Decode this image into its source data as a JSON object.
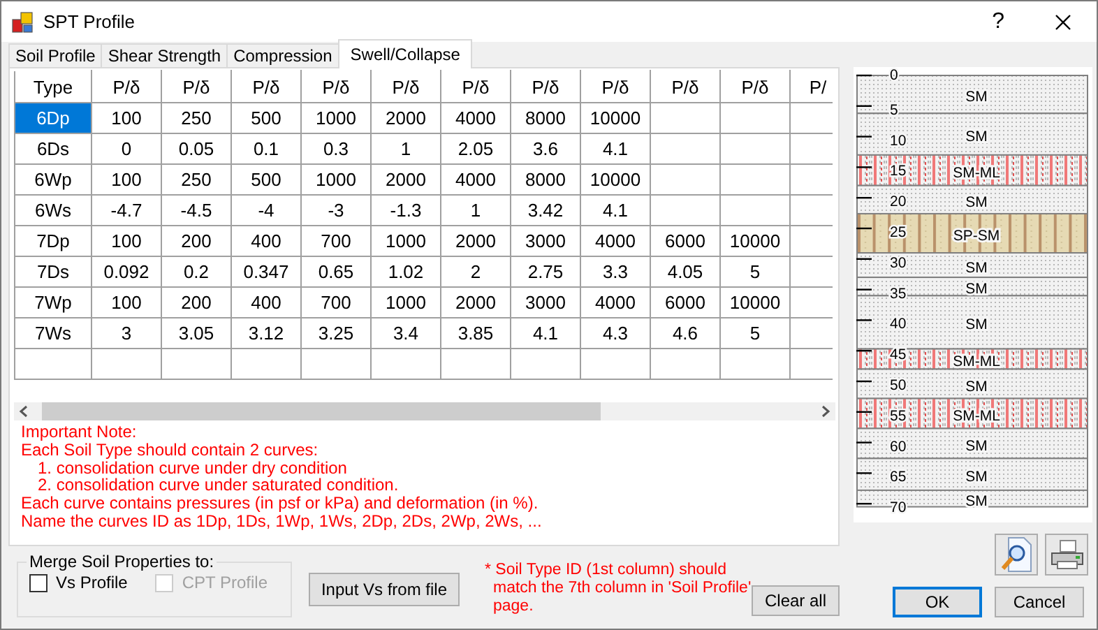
{
  "window": {
    "title": "SPT Profile",
    "help": "?"
  },
  "tabs": [
    {
      "label": "Soil Profile",
      "selected": false
    },
    {
      "label": "Shear Strength",
      "selected": false
    },
    {
      "label": "Compression",
      "selected": false
    },
    {
      "label": "Swell/Collapse",
      "selected": true
    }
  ],
  "table": {
    "columns": [
      "Type",
      "P/δ",
      "P/δ",
      "P/δ",
      "P/δ",
      "P/δ",
      "P/δ",
      "P/δ",
      "P/δ",
      "P/δ",
      "P/δ",
      "P/"
    ],
    "rows": [
      {
        "selected": true,
        "cells": [
          "6Dp",
          "100",
          "250",
          "500",
          "1000",
          "2000",
          "4000",
          "8000",
          "10000"
        ]
      },
      {
        "selected": false,
        "cells": [
          "6Ds",
          "0",
          "0.05",
          "0.1",
          "0.3",
          "1",
          "2.05",
          "3.6",
          "4.1"
        ]
      },
      {
        "selected": false,
        "cells": [
          "6Wp",
          "100",
          "250",
          "500",
          "1000",
          "2000",
          "4000",
          "8000",
          "10000"
        ]
      },
      {
        "selected": false,
        "cells": [
          "6Ws",
          "-4.7",
          "-4.5",
          "-4",
          "-3",
          "-1.3",
          "1",
          "3.42",
          "4.1"
        ]
      },
      {
        "selected": false,
        "cells": [
          "7Dp",
          "100",
          "200",
          "400",
          "700",
          "1000",
          "2000",
          "3000",
          "4000",
          "6000",
          "10000"
        ]
      },
      {
        "selected": false,
        "cells": [
          "7Ds",
          "0.092",
          "0.2",
          "0.347",
          "0.65",
          "1.02",
          "2",
          "2.75",
          "3.3",
          "4.05",
          "5"
        ]
      },
      {
        "selected": false,
        "cells": [
          "7Wp",
          "100",
          "200",
          "400",
          "700",
          "1000",
          "2000",
          "3000",
          "4000",
          "6000",
          "10000"
        ]
      },
      {
        "selected": false,
        "cells": [
          "7Ws",
          "3",
          "3.05",
          "3.12",
          "3.25",
          "3.4",
          "3.85",
          "4.1",
          "4.3",
          "4.6",
          "5"
        ]
      }
    ]
  },
  "note": [
    {
      "kind": "line",
      "text": "Important Note:"
    },
    {
      "kind": "line",
      "text": "Each Soil Type should contain 2 curves:"
    },
    {
      "kind": "item",
      "text": "1. consolidation curve under dry condition"
    },
    {
      "kind": "item",
      "text": "2. consolidation curve under saturated condition."
    },
    {
      "kind": "line",
      "text": "Each curve contains pressures (in psf or kPa) and deformation (in %)."
    },
    {
      "kind": "line",
      "text": "Name the curves ID as 1Dp, 1Ds, 1Wp, 1Ws, 2Dp, 2Ds, 2Wp, 2Ws, ..."
    }
  ],
  "profile": {
    "ticks": [
      "0",
      "5",
      "10",
      "15",
      "20",
      "25",
      "30",
      "35",
      "40",
      "45",
      "50",
      "55",
      "60",
      "65",
      "70"
    ],
    "layers": [
      {
        "label": "SM",
        "kind": "sm"
      },
      {
        "label": "SM",
        "kind": "sm"
      },
      {
        "label": "SM-ML",
        "kind": "sm-ml"
      },
      {
        "label": "SM",
        "kind": "sm"
      },
      {
        "label": "SP-SM",
        "kind": "sp-sm"
      },
      {
        "label": "SM",
        "kind": "sm"
      },
      {
        "label": "SM",
        "kind": "sm"
      },
      {
        "label": "SM",
        "kind": "sm"
      },
      {
        "label": "SM-ML",
        "kind": "sm-ml"
      },
      {
        "label": "SM",
        "kind": "sm"
      },
      {
        "label": "SM-ML",
        "kind": "sm-ml"
      },
      {
        "label": "SM",
        "kind": "sm"
      },
      {
        "label": "SM",
        "kind": "sm"
      },
      {
        "label": "SM",
        "kind": "sm"
      }
    ]
  },
  "merge": {
    "title": "Merge Soil Properties to:",
    "options": [
      {
        "label": "Vs Profile",
        "checked": false,
        "disabled": false
      },
      {
        "label": "CPT Profile",
        "checked": false,
        "disabled": true
      }
    ]
  },
  "input_button": "Input Vs from file",
  "id_note": "* Soil Type ID (1st column) should match the 7th column in 'Soil Profile' page.",
  "buttons": [
    {
      "label": "Clear all",
      "focused": false
    },
    {
      "label": "OK",
      "focused": true
    },
    {
      "label": "Cancel",
      "focused": false
    }
  ]
}
